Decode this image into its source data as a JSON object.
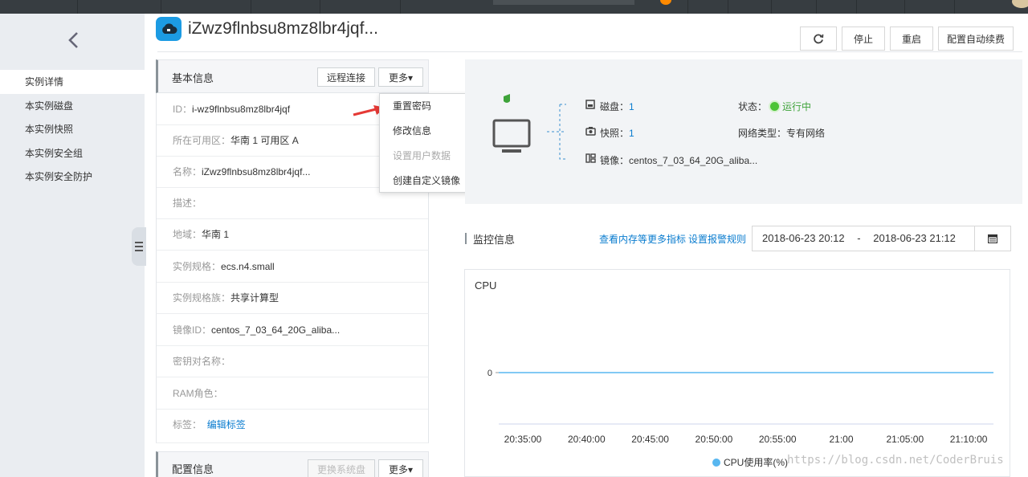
{
  "header": {
    "title": "iZwz9flnbsu8mz8lbr4jqf...",
    "refresh_icon": "refresh-icon",
    "buttons": {
      "stop": "停止",
      "restart": "重启",
      "auto_renew": "配置自动续费"
    }
  },
  "sidebar": {
    "back_icon": "chevron-left-icon",
    "items": [
      {
        "label": "实例详情",
        "active": true
      },
      {
        "label": "本实例磁盘"
      },
      {
        "label": "本实例快照"
      },
      {
        "label": "本实例安全组"
      },
      {
        "label": "本实例安全防护"
      }
    ]
  },
  "basic_info": {
    "title": "基本信息",
    "remote_connect": "远程连接",
    "more": "更多▾",
    "rows": [
      {
        "k": "ID：",
        "v": "i-wz9flnbsu8mz8lbr4jqf"
      },
      {
        "k": "所在可用区：",
        "v": "华南 1 可用区 A"
      },
      {
        "k": "名称：",
        "v": "iZwz9flnbsu8mz8lbr4jqf..."
      },
      {
        "k": "描述：",
        "v": ""
      },
      {
        "k": "地域：",
        "v": "华南 1"
      },
      {
        "k": "实例规格：",
        "v": "ecs.n4.small"
      },
      {
        "k": "实例规格族：",
        "v": "共享计算型"
      },
      {
        "k": "镜像ID：",
        "v": "centos_7_03_64_20G_aliba..."
      },
      {
        "k": "密钥对名称：",
        "v": ""
      },
      {
        "k": "RAM角色：",
        "v": ""
      },
      {
        "k": "标签：",
        "link": "编辑标签"
      }
    ]
  },
  "config_info": {
    "title": "配置信息",
    "change_disk": "更换系统盘",
    "more": "更多▾"
  },
  "dropdown": {
    "items": [
      {
        "label": "重置密码"
      },
      {
        "label": "修改信息"
      },
      {
        "label": "设置用户数据",
        "disabled": true
      },
      {
        "label": "创建自定义镜像"
      }
    ]
  },
  "overview": {
    "disk_label": "磁盘：",
    "disk_count": "1",
    "snapshot_label": "快照：",
    "snapshot_count": "1",
    "image_label": "镜像：",
    "image_value": "centos_7_03_64_20G_aliba...",
    "status_label": "状态：",
    "status_value": "运行中",
    "network_label": "网络类型：",
    "network_value": "专有网络"
  },
  "monitor": {
    "title": "监控信息",
    "link_more": "查看内存等更多指标",
    "link_alarm": "设置报警规则",
    "range_start": "2018-06-23 20:12",
    "range_sep": "-",
    "range_end": "2018-06-23 21:12",
    "calendar_icon": "calendar-icon"
  },
  "chart_data": {
    "type": "line",
    "title": "CPU",
    "x": [
      "20:35:00",
      "20:40:00",
      "20:45:00",
      "20:50:00",
      "20:55:00",
      "21:00",
      "21:05:00",
      "21:10:00"
    ],
    "series": [
      {
        "name": "CPU使用率(%)",
        "values": [
          0,
          0,
          0,
          0,
          0,
          0,
          0,
          0
        ],
        "color": "#58b7f0"
      }
    ],
    "yticks": [
      "0"
    ],
    "legend": "bottom"
  },
  "watermark": "https://blog.csdn.net/CoderBruis"
}
